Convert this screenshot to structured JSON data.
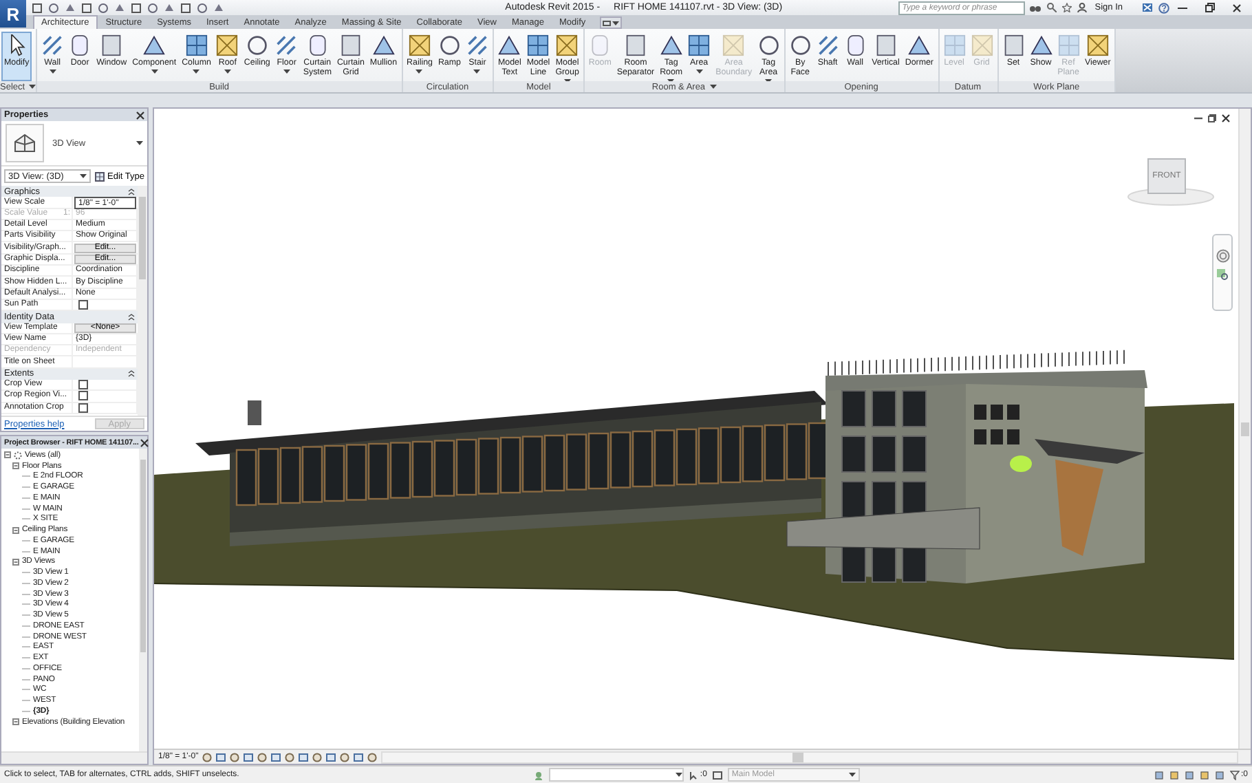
{
  "window": {
    "logo": "R",
    "app_title": "Autodesk Revit 2015 -",
    "document_title": "RIFT HOME 141107.rvt - 3D View: (3D)",
    "search": {
      "placeholder": "Type a keyword or phrase"
    },
    "sign_in": "Sign In"
  },
  "tabs": [
    {
      "label": "Architecture",
      "selected": true
    },
    {
      "label": "Structure",
      "selected": false
    },
    {
      "label": "Systems",
      "selected": false
    },
    {
      "label": "Insert",
      "selected": false
    },
    {
      "label": "Annotate",
      "selected": false
    },
    {
      "label": "Analyze",
      "selected": false
    },
    {
      "label": "Massing & Site",
      "selected": false
    },
    {
      "label": "Collaborate",
      "selected": false
    },
    {
      "label": "View",
      "selected": false
    },
    {
      "label": "Manage",
      "selected": false
    },
    {
      "label": "Modify",
      "selected": false
    }
  ],
  "ribbon": {
    "panels": [
      {
        "label": "Select",
        "menu": true,
        "tools": [
          {
            "label": "Modify",
            "selected": true,
            "disabled": false,
            "dropdown": false
          }
        ]
      },
      {
        "label": "Build",
        "menu": false,
        "tools": [
          {
            "label": "Wall",
            "selected": false,
            "disabled": false,
            "dropdown": true
          },
          {
            "label": "Door",
            "selected": false,
            "disabled": false,
            "dropdown": false
          },
          {
            "label": "Window",
            "selected": false,
            "disabled": false,
            "dropdown": false
          },
          {
            "label": "Component",
            "selected": false,
            "disabled": false,
            "dropdown": true
          },
          {
            "label": "Column",
            "selected": false,
            "disabled": false,
            "dropdown": true
          },
          {
            "label": "Roof",
            "selected": false,
            "disabled": false,
            "dropdown": true
          },
          {
            "label": "Ceiling",
            "selected": false,
            "disabled": false,
            "dropdown": false
          },
          {
            "label": "Floor",
            "selected": false,
            "disabled": false,
            "dropdown": true
          },
          {
            "label": "Curtain System",
            "selected": false,
            "disabled": false,
            "dropdown": false
          },
          {
            "label": "Curtain Grid",
            "selected": false,
            "disabled": false,
            "dropdown": false
          },
          {
            "label": "Mullion",
            "selected": false,
            "disabled": false,
            "dropdown": false
          }
        ]
      },
      {
        "label": "Circulation",
        "menu": false,
        "tools": [
          {
            "label": "Railing",
            "selected": false,
            "disabled": false,
            "dropdown": true
          },
          {
            "label": "Ramp",
            "selected": false,
            "disabled": false,
            "dropdown": false
          },
          {
            "label": "Stair",
            "selected": false,
            "disabled": false,
            "dropdown": true
          }
        ]
      },
      {
        "label": "Model",
        "menu": false,
        "tools": [
          {
            "label": "Model Text",
            "selected": false,
            "disabled": false,
            "dropdown": false
          },
          {
            "label": "Model Line",
            "selected": false,
            "disabled": false,
            "dropdown": false
          },
          {
            "label": "Model Group",
            "selected": false,
            "disabled": false,
            "dropdown": true
          }
        ]
      },
      {
        "label": "Room & Area",
        "menu": true,
        "tools": [
          {
            "label": "Room",
            "selected": false,
            "disabled": true,
            "dropdown": false
          },
          {
            "label": "Room Separator",
            "selected": false,
            "disabled": false,
            "dropdown": false
          },
          {
            "label": "Tag Room",
            "selected": false,
            "disabled": false,
            "dropdown": true
          },
          {
            "label": "Area",
            "selected": false,
            "disabled": false,
            "dropdown": true
          },
          {
            "label": "Area Boundary",
            "selected": false,
            "disabled": true,
            "dropdown": false
          },
          {
            "label": "Tag Area",
            "selected": false,
            "disabled": false,
            "dropdown": true
          }
        ]
      },
      {
        "label": "Opening",
        "menu": false,
        "tools": [
          {
            "label": "By Face",
            "selected": false,
            "disabled": false,
            "dropdown": false
          },
          {
            "label": "Shaft",
            "selected": false,
            "disabled": false,
            "dropdown": false
          },
          {
            "label": "Wall",
            "selected": false,
            "disabled": false,
            "dropdown": false
          },
          {
            "label": "Vertical",
            "selected": false,
            "disabled": false,
            "dropdown": false
          },
          {
            "label": "Dormer",
            "selected": false,
            "disabled": false,
            "dropdown": false
          }
        ]
      },
      {
        "label": "Datum",
        "menu": false,
        "tools": [
          {
            "label": "Level",
            "selected": false,
            "disabled": true,
            "dropdown": false
          },
          {
            "label": "Grid",
            "selected": false,
            "disabled": true,
            "dropdown": false
          }
        ]
      },
      {
        "label": "Work Plane",
        "menu": false,
        "tools": [
          {
            "label": "Set",
            "selected": false,
            "disabled": false,
            "dropdown": false
          },
          {
            "label": "Show",
            "selected": false,
            "disabled": false,
            "dropdown": false
          },
          {
            "label": "Ref Plane",
            "selected": false,
            "disabled": true,
            "dropdown": false
          },
          {
            "label": "Viewer",
            "selected": false,
            "disabled": false,
            "dropdown": false
          }
        ]
      }
    ]
  },
  "properties": {
    "title": "Properties",
    "type_name": "3D View",
    "instance": "3D View: (3D)",
    "edit_type": "Edit Type",
    "groups": [
      {
        "name": "Graphics",
        "rows": [
          {
            "kind": "field",
            "label": "View Scale",
            "value": "1/8\" = 1'-0\"",
            "disabled": false
          },
          {
            "kind": "text",
            "label": "Scale Value",
            "suffix": "1:",
            "value": "96",
            "disabled": true
          },
          {
            "kind": "text",
            "label": "Detail Level",
            "value": "Medium",
            "disabled": false
          },
          {
            "kind": "text",
            "label": "Parts Visibility",
            "value": "Show Original",
            "disabled": false
          },
          {
            "kind": "button",
            "label": "Visibility/Graph...",
            "value": "Edit...",
            "disabled": false
          },
          {
            "kind": "button",
            "label": "Graphic Displa...",
            "value": "Edit...",
            "disabled": false
          },
          {
            "kind": "text",
            "label": "Discipline",
            "value": "Coordination",
            "disabled": false
          },
          {
            "kind": "text",
            "label": "Show Hidden L...",
            "value": "By Discipline",
            "disabled": false
          },
          {
            "kind": "text",
            "label": "Default Analysi...",
            "value": "None",
            "disabled": false
          },
          {
            "kind": "checkbox",
            "label": "Sun Path",
            "checked": false,
            "disabled": false
          }
        ]
      },
      {
        "name": "Identity Data",
        "rows": [
          {
            "kind": "button",
            "label": "View Template",
            "value": "<None>",
            "disabled": false
          },
          {
            "kind": "text",
            "label": "View Name",
            "value": "{3D}",
            "disabled": false
          },
          {
            "kind": "text",
            "label": "Dependency",
            "value": "Independent",
            "disabled": true
          },
          {
            "kind": "text",
            "label": "Title on Sheet",
            "value": "",
            "disabled": false
          }
        ]
      },
      {
        "name": "Extents",
        "rows": [
          {
            "kind": "checkbox",
            "label": "Crop View",
            "checked": false,
            "disabled": false
          },
          {
            "kind": "checkbox",
            "label": "Crop Region Vi...",
            "checked": false,
            "disabled": false
          },
          {
            "kind": "checkbox",
            "label": "Annotation Crop",
            "checked": false,
            "disabled": false
          }
        ]
      }
    ],
    "help_link": "Properties help",
    "apply": {
      "label": "Apply",
      "disabled": true
    }
  },
  "project_browser": {
    "title": "Project Browser - RIFT HOME 141107...",
    "tree": [
      {
        "label": "Views (all)",
        "expanded": true,
        "children": [
          {
            "label": "Floor Plans",
            "expanded": true,
            "children": [
              {
                "label": "E 2nd FLOOR",
                "selected": false
              },
              {
                "label": "E GARAGE",
                "selected": false
              },
              {
                "label": "E MAIN",
                "selected": false
              },
              {
                "label": "W MAIN",
                "selected": false
              },
              {
                "label": "X SITE",
                "selected": false
              }
            ]
          },
          {
            "label": "Ceiling Plans",
            "expanded": true,
            "children": [
              {
                "label": "E GARAGE",
                "selected": false
              },
              {
                "label": "E MAIN",
                "selected": false
              }
            ]
          },
          {
            "label": "3D Views",
            "expanded": true,
            "children": [
              {
                "label": "3D View 1",
                "selected": false
              },
              {
                "label": "3D View 2",
                "selected": false
              },
              {
                "label": "3D View 3",
                "selected": false
              },
              {
                "label": "3D View 4",
                "selected": false
              },
              {
                "label": "3D View 5",
                "selected": false
              },
              {
                "label": "DRONE EAST",
                "selected": false
              },
              {
                "label": "DRONE WEST",
                "selected": false
              },
              {
                "label": "EAST",
                "selected": false
              },
              {
                "label": "EXT",
                "selected": false
              },
              {
                "label": "OFFICE",
                "selected": false
              },
              {
                "label": "PANO",
                "selected": false
              },
              {
                "label": "WC",
                "selected": false
              },
              {
                "label": "WEST",
                "selected": false
              },
              {
                "label": "{3D}",
                "selected": true
              }
            ]
          },
          {
            "label": "Elevations (Building Elevation",
            "expanded": true
          }
        ]
      }
    ]
  },
  "view": {
    "viewcube_face": "FRONT",
    "scale": "1/8\" = 1'-0\""
  },
  "status_bar": {
    "message": "Click to select, TAB for alternates, CTRL adds, SHIFT unselects.",
    "selection_count": ":0",
    "model": "Main Model",
    "filter_count": ":0"
  }
}
